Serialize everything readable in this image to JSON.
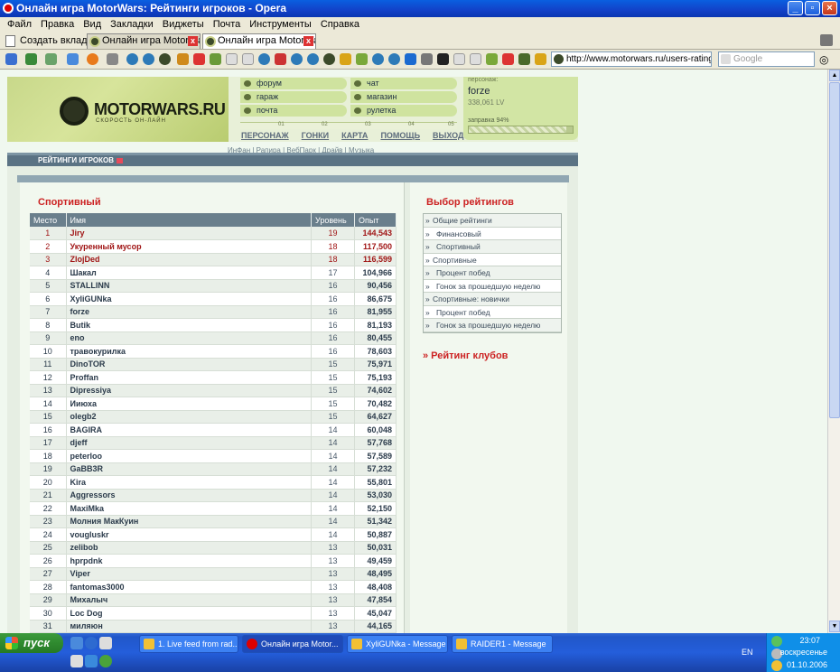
{
  "window": {
    "title": "Онлайн игра MotorWars: Рейтинги игроков - Opera"
  },
  "menu": [
    "Файл",
    "Правка",
    "Вид",
    "Закладки",
    "Виджеты",
    "Почта",
    "Инструменты",
    "Справка"
  ],
  "tabs": {
    "new_tab": "Создать вкладку",
    "items": [
      "Онлайн игра MotorWars...",
      "Онлайн игра MotorWars..."
    ]
  },
  "address": {
    "url": "http://www.motorwars.ru/users-rating.php",
    "search_placeholder": "Google"
  },
  "site": {
    "logo_name": "MOTORWARS.RU",
    "logo_sub": "СКОРОСТЬ ОН-ЛАЙН",
    "nav": [
      "форум",
      "гараж",
      "почта",
      "чат",
      "магазин",
      "рулетка"
    ],
    "ruler": [
      "01",
      "02",
      "03",
      "04",
      "05"
    ],
    "top_links": [
      "ПЕРСОНАЖ",
      "ГОНКИ",
      "КАРТА",
      "ПОМОЩЬ",
      "ВЫХОД"
    ],
    "sub_links": [
      "ИнФан",
      "Рапира",
      "ВебПарк",
      "Драйв",
      "Музыка"
    ],
    "persona": {
      "label": "персонаж:",
      "name": "forze",
      "lv": "338,061 LV",
      "fuel_label": "заправка 94%",
      "fuel": 0.94
    }
  },
  "section_title": "РЕЙТИНГИ ИГРОКОВ",
  "rating": {
    "title": "Спортивный",
    "headers": [
      "Место",
      "Имя",
      "Уровень",
      "Опыт"
    ],
    "rows": [
      [
        "1",
        "Jiry",
        "19",
        "144,543"
      ],
      [
        "2",
        "Укуренный мусор",
        "18",
        "117,500"
      ],
      [
        "3",
        "ZlojDed",
        "18",
        "116,599"
      ],
      [
        "4",
        "Шакал",
        "17",
        "104,966"
      ],
      [
        "5",
        "STALLINN",
        "16",
        "90,456"
      ],
      [
        "6",
        "XyliGUNka",
        "16",
        "86,675"
      ],
      [
        "7",
        "forze",
        "16",
        "81,955"
      ],
      [
        "8",
        "Butik",
        "16",
        "81,193"
      ],
      [
        "9",
        "eno",
        "16",
        "80,455"
      ],
      [
        "10",
        "травокурилка",
        "16",
        "78,603"
      ],
      [
        "11",
        "DinoTOR",
        "15",
        "75,971"
      ],
      [
        "12",
        "Proffan",
        "15",
        "75,193"
      ],
      [
        "13",
        "Dipressiya",
        "15",
        "74,602"
      ],
      [
        "14",
        "Ииюха",
        "15",
        "70,482"
      ],
      [
        "15",
        "olegb2",
        "15",
        "64,627"
      ],
      [
        "16",
        "BAGIRA",
        "14",
        "60,048"
      ],
      [
        "17",
        "djeff",
        "14",
        "57,768"
      ],
      [
        "18",
        "peterloo",
        "14",
        "57,589"
      ],
      [
        "19",
        "GaBB3R",
        "14",
        "57,232"
      ],
      [
        "20",
        "Kira",
        "14",
        "55,801"
      ],
      [
        "21",
        "Aggressors",
        "14",
        "53,030"
      ],
      [
        "22",
        "MaxiMka",
        "14",
        "52,150"
      ],
      [
        "23",
        "Молния МакКуин",
        "14",
        "51,342"
      ],
      [
        "24",
        "vougluskr",
        "14",
        "50,887"
      ],
      [
        "25",
        "zelibob",
        "13",
        "50,031"
      ],
      [
        "26",
        "hprpdnk",
        "13",
        "49,459"
      ],
      [
        "27",
        "Viper",
        "13",
        "48,495"
      ],
      [
        "28",
        "fantomas3000",
        "13",
        "48,408"
      ],
      [
        "29",
        "Михалыч",
        "13",
        "47,854"
      ],
      [
        "30",
        "Loc Dog",
        "13",
        "45,047"
      ],
      [
        "31",
        "миляюн",
        "13",
        "44,165"
      ]
    ]
  },
  "ratings_menu": {
    "title": "Выбор рейтингов",
    "items": [
      "Общие рейтинги",
      "Финансовый",
      "Спортивный",
      "Спортивные",
      "Процент побед",
      "Гонок за прошедшую неделю",
      "Спортивные: новички",
      "Процент побед",
      "Гонок за прошедшую неделю"
    ],
    "clubs": "» Рейтинг клубов"
  },
  "taskbar": {
    "start": "пуск",
    "tasks": [
      "1. Live feed from rad...",
      "Онлайн игра Motor...",
      "XyliGUNka - Message",
      "RAIDER1 - Message"
    ],
    "lang": "EN",
    "time": "23:07",
    "day": "воскресенье",
    "date": "01.10.2006"
  }
}
